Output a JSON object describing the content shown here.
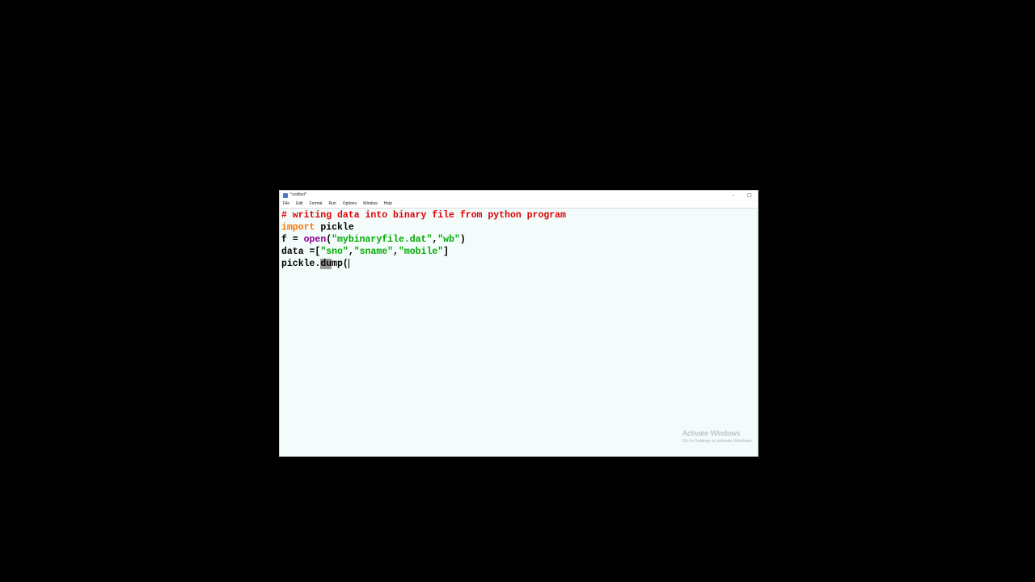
{
  "window": {
    "title": "*untitled*",
    "controls": {
      "minimize": "–",
      "maximize": "□"
    }
  },
  "menu": {
    "items": [
      "File",
      "Edit",
      "Format",
      "Run",
      "Options",
      "Window",
      "Help"
    ]
  },
  "editor": {
    "line1": {
      "comment": "# writing data into binary file from python program"
    },
    "line2": {
      "keyword": "import",
      "rest": " pickle"
    },
    "line3": {
      "lhs": "f = ",
      "func": "open",
      "open_paren": "(",
      "arg1": "\"mybinaryfile.dat\"",
      "comma": ",",
      "arg2": "\"wb\"",
      "close_paren": ")"
    },
    "line4": {
      "lhs": "data =[",
      "item1": "\"sno\"",
      "comma1": ",",
      "item2": "\"sname\"",
      "comma2": ",",
      "item3": "\"mobile\"",
      "close": "]"
    },
    "line5": {
      "prefix": "pickle.",
      "selected": "du",
      "rest": "mp("
    }
  },
  "watermark": {
    "title": "Activate Windows",
    "subtitle": "Go to Settings to activate Windows."
  },
  "colors": {
    "comment": "#dd0000",
    "keyword": "#ff7700",
    "builtin": "#900090",
    "string": "#00aa00",
    "editor_bg": "#f3fcfb",
    "screen_bg": "#000000"
  }
}
